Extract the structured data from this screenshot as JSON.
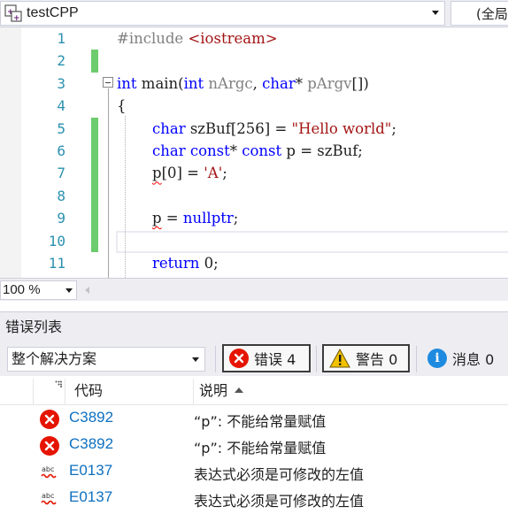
{
  "navbar": {
    "project": "testCPP",
    "scope": "(全局"
  },
  "editor": {
    "lines": [
      {
        "n": "1"
      },
      {
        "n": "2"
      },
      {
        "n": "3"
      },
      {
        "n": "4"
      },
      {
        "n": "5"
      },
      {
        "n": "6"
      },
      {
        "n": "7"
      },
      {
        "n": "8"
      },
      {
        "n": "9"
      },
      {
        "n": "10"
      },
      {
        "n": "11"
      }
    ],
    "code": {
      "l1_pp": "#include ",
      "l1_hdr": "<iostream>",
      "l3_kw": "int",
      "l3_name": " main(",
      "l3_kw2": "int",
      "l3_p1": " nArgc",
      "l3_comma": ", ",
      "l3_kw3": "char",
      "l3_star": "* ",
      "l3_p2": "pArgv",
      "l3_end": "[])",
      "l4": "{",
      "l5_kw": "char",
      "l5_rest": " szBuf[256] = ",
      "l5_str": "\"Hello world\"",
      "l5_end": ";",
      "l6_kw": "char",
      "l6_sp": " ",
      "l6_kw2": "const",
      "l6_star": "* ",
      "l6_kw3": "const",
      "l6_rest": " p = szBuf;",
      "l7_p": "p",
      "l7_rest": "[0] = ",
      "l7_str": "'A'",
      "l7_end": ";",
      "l9_p": "p",
      "l9_rest": " = ",
      "l9_kw": "nullptr",
      "l9_end": ";",
      "l11_kw": "return",
      "l11_rest": " 0;"
    }
  },
  "zoom": {
    "value": "100 %"
  },
  "error_list": {
    "title": "错误列表",
    "scope": "整个解决方案",
    "filters": {
      "errors": "错误 4",
      "warnings": "警告 0",
      "messages": "消息 0"
    },
    "columns": {
      "code": "代码",
      "description": "说明"
    },
    "rows": [
      {
        "type": "error",
        "code": "C3892",
        "desc": "“p”: 不能给常量赋值"
      },
      {
        "type": "error",
        "code": "C3892",
        "desc": "“p”: 不能给常量赋值"
      },
      {
        "type": "intellisense",
        "code": "E0137",
        "desc": "表达式必须是可修改的左值"
      },
      {
        "type": "intellisense",
        "code": "E0137",
        "desc": "表达式必须是可修改的左值"
      }
    ],
    "colors": {
      "error": "#e51400",
      "link": "#0e70c0",
      "info": "#1e8be0",
      "warning": "#f2c200"
    }
  }
}
